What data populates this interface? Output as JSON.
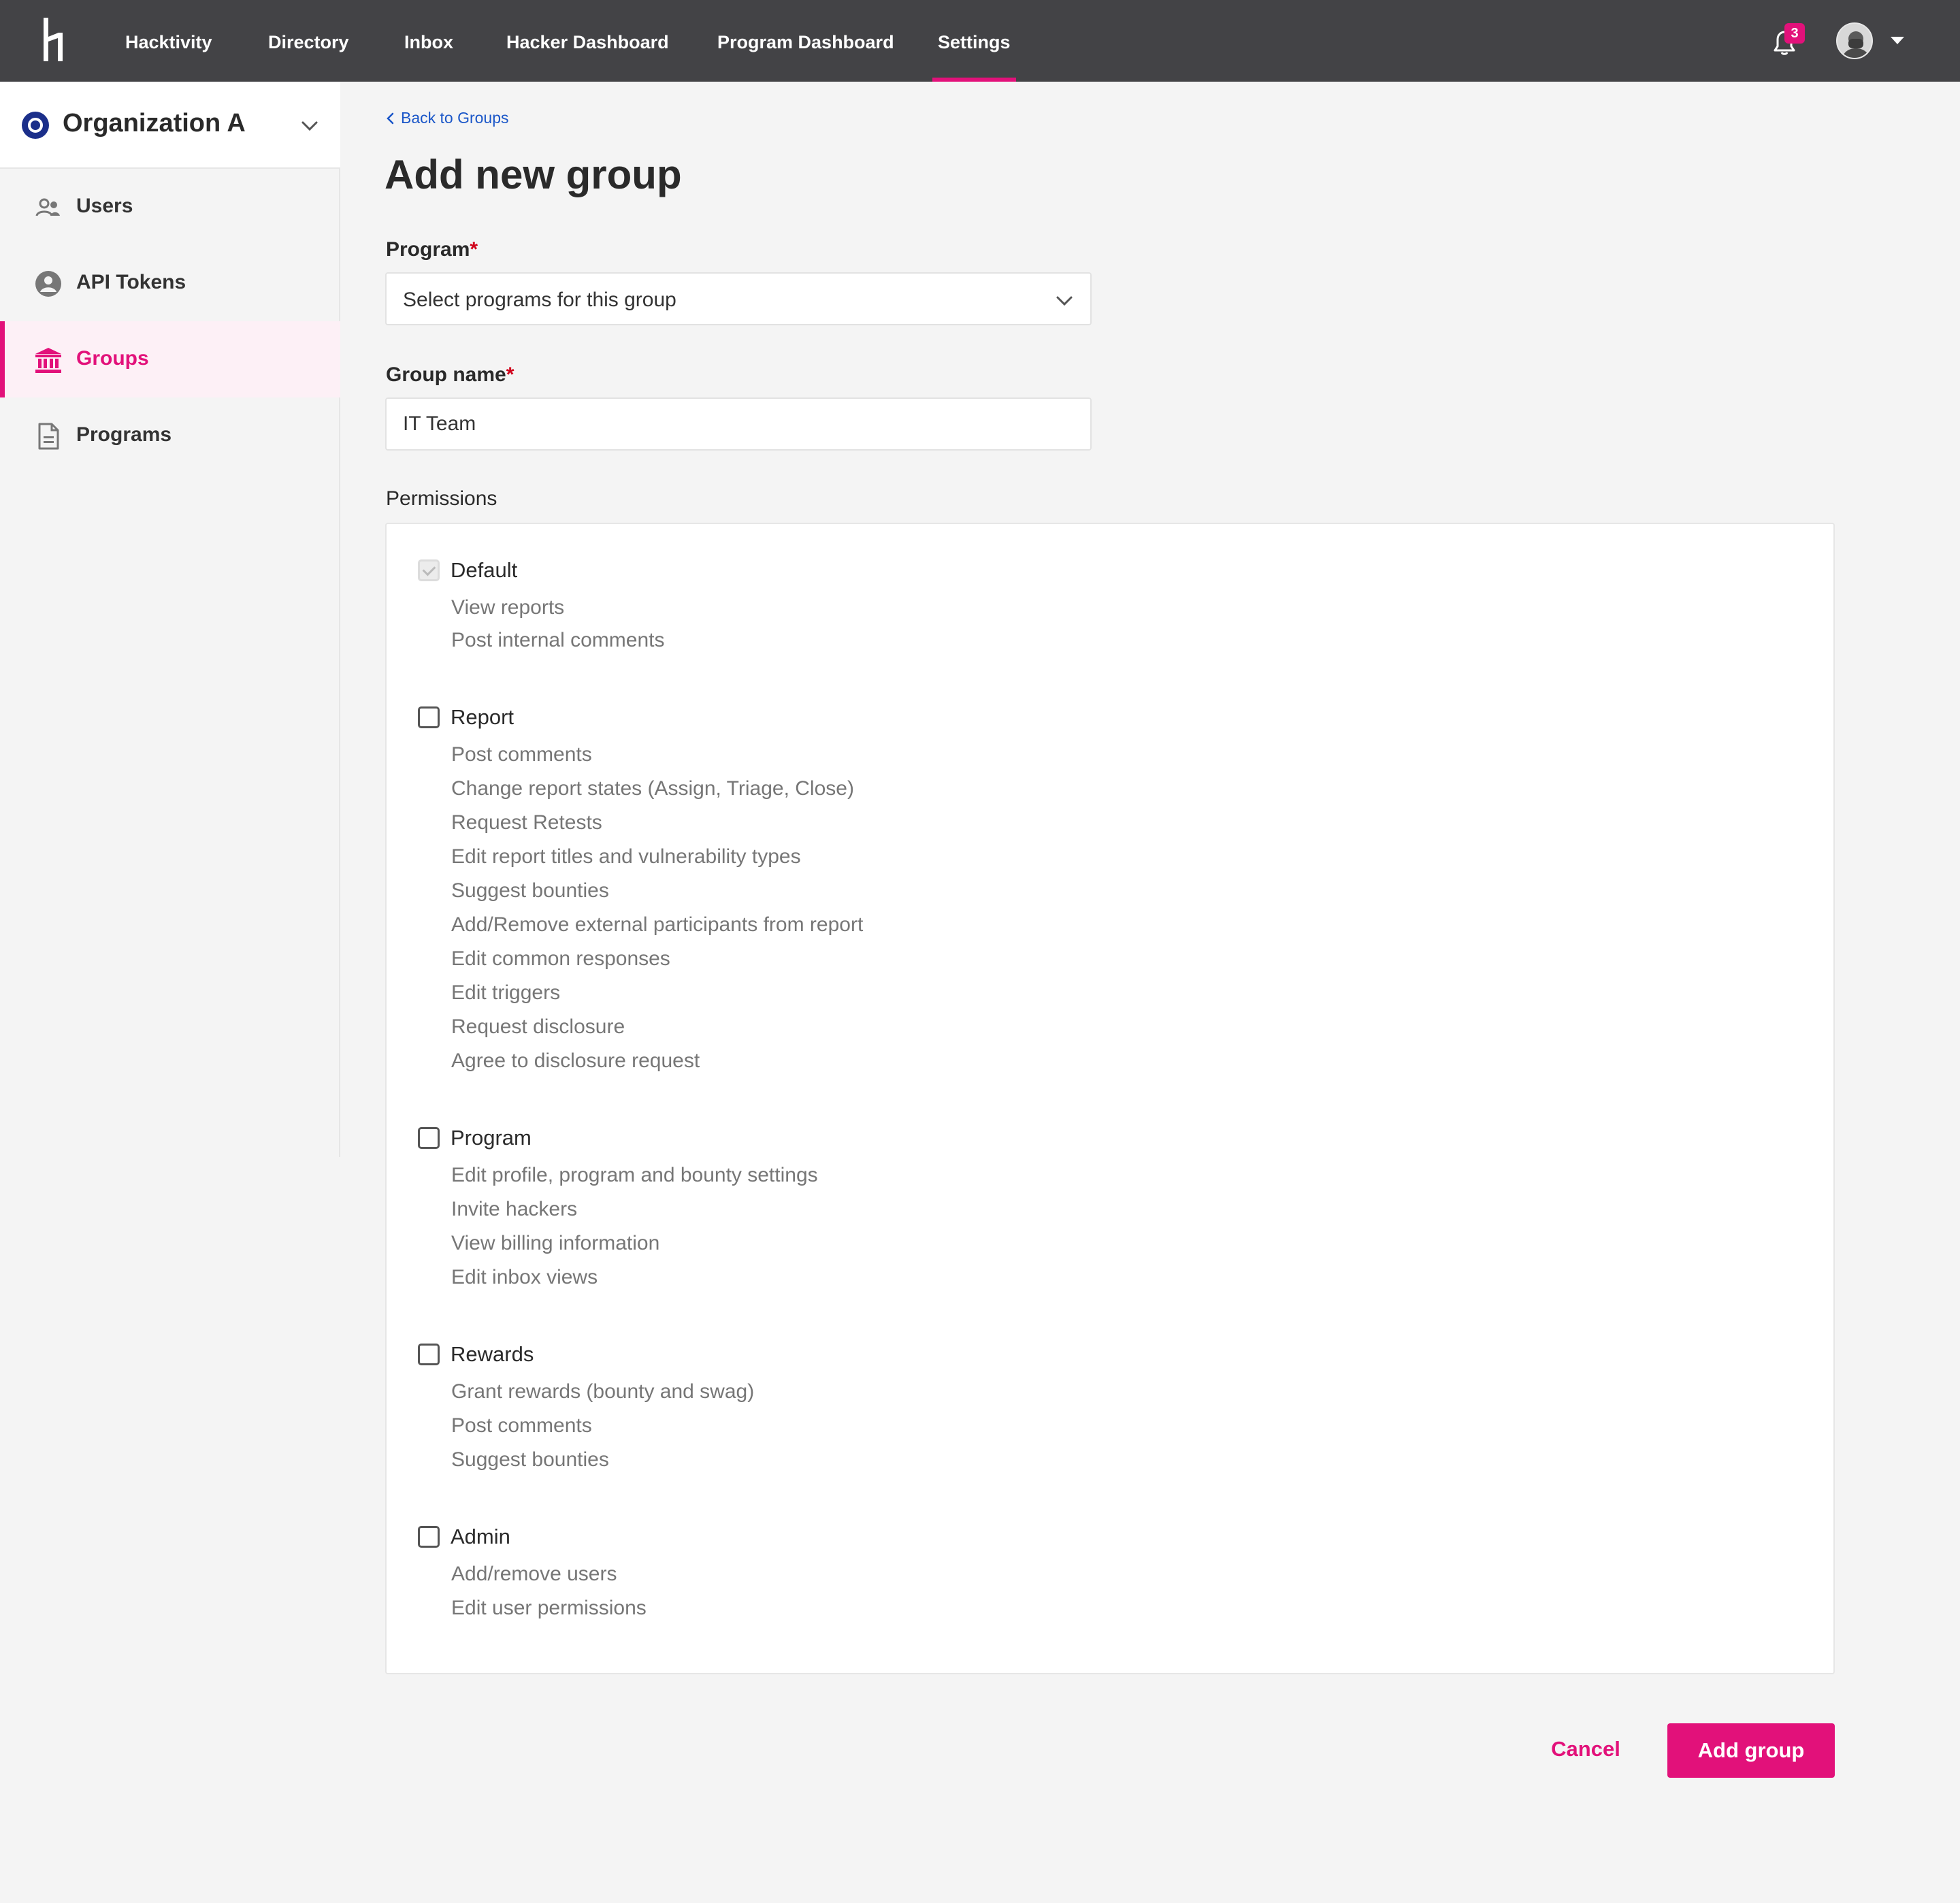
{
  "nav": {
    "logo": "hackerone-logo",
    "links": [
      "Hacktivity",
      "Directory",
      "Inbox",
      "Hacker Dashboard",
      "Program Dashboard",
      "Settings"
    ],
    "active": "Settings",
    "notification_count": "3",
    "accent_color": "#e2117a",
    "background_color": "#434346"
  },
  "sidebar": {
    "org_name": "Organization A",
    "items": [
      {
        "label": "Users",
        "icon": "users-icon"
      },
      {
        "label": "API Tokens",
        "icon": "user-circle-icon"
      },
      {
        "label": "Groups",
        "icon": "bank-icon"
      },
      {
        "label": "Programs",
        "icon": "document-icon"
      }
    ],
    "active": "Groups"
  },
  "main": {
    "back_link": "Back to Groups",
    "title": "Add new group",
    "program_label": "Program",
    "program_placeholder": "Select programs for this group",
    "group_name_label": "Group name",
    "group_name_value": "IT Team",
    "required_marker": "*",
    "permissions_heading": "Permissions",
    "groups": [
      {
        "title": "Default",
        "checked": true,
        "disabled": true,
        "items": [
          "View reports",
          "Post internal comments"
        ]
      },
      {
        "title": "Report",
        "checked": false,
        "disabled": false,
        "items": [
          "Post comments",
          "Change report states (Assign, Triage, Close)",
          "Request Retests",
          "Edit report titles and vulnerability types",
          "Suggest bounties",
          "Add/Remove external participants from report",
          "Edit common responses",
          "Edit triggers",
          "Request disclosure",
          "Agree to disclosure request"
        ]
      },
      {
        "title": "Program",
        "checked": false,
        "disabled": false,
        "items": [
          "Edit profile, program and bounty settings",
          "Invite hackers",
          "View billing information",
          "Edit inbox views"
        ]
      },
      {
        "title": "Rewards",
        "checked": false,
        "disabled": false,
        "items": [
          "Grant rewards (bounty and swag)",
          "Post comments",
          "Suggest bounties"
        ]
      },
      {
        "title": "Admin",
        "checked": false,
        "disabled": false,
        "items": [
          "Add/remove users",
          "Edit user permissions"
        ]
      }
    ]
  },
  "actions": {
    "cancel": "Cancel",
    "submit": "Add group"
  }
}
